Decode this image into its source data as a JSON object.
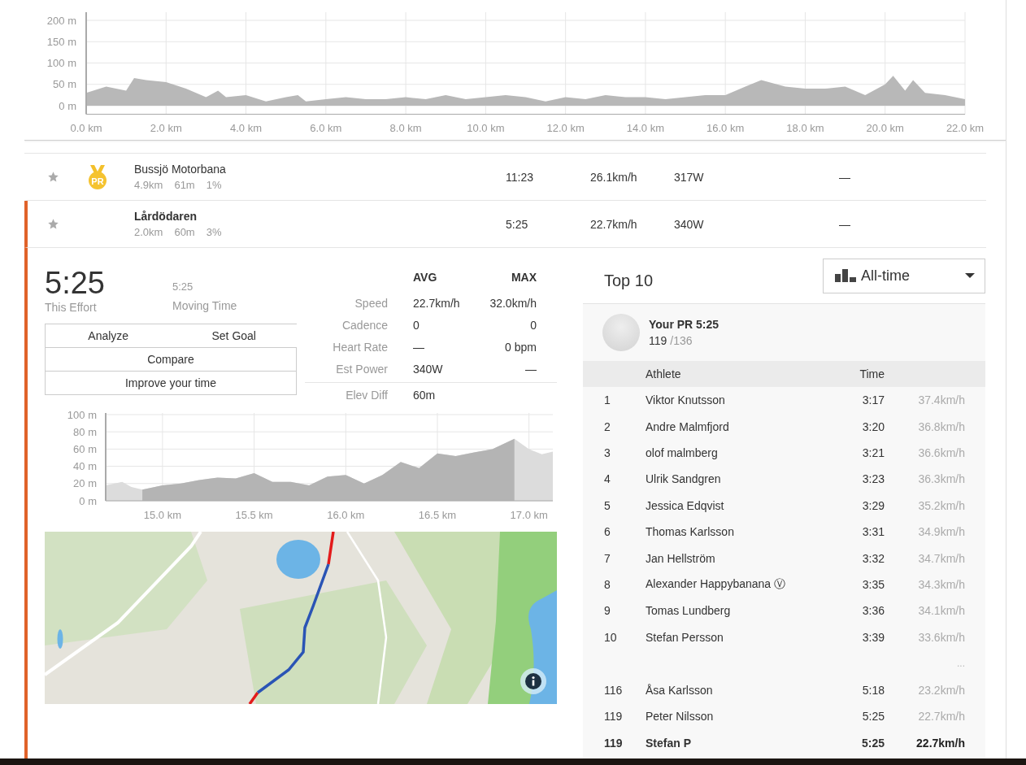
{
  "elevation_profile": {
    "chart_data": {
      "type": "area",
      "x": [
        0,
        0.5,
        1,
        1.2,
        1.5,
        2,
        2.5,
        3,
        3.3,
        3.5,
        4,
        4.5,
        5,
        5.3,
        5.5,
        6,
        6.5,
        7,
        7.5,
        8,
        8.5,
        9,
        9.5,
        10,
        10.5,
        11,
        11.5,
        12,
        12.5,
        13,
        13.5,
        14,
        14.5,
        15,
        15.5,
        16,
        16.5,
        16.9,
        17.5,
        18,
        18.5,
        19,
        19.5,
        20,
        20.2,
        20.5,
        20.7,
        21,
        21.5,
        22
      ],
      "grid": true,
      "series": [
        {
          "color": "#b8b8b8",
          "values": [
            30,
            45,
            35,
            65,
            60,
            55,
            40,
            20,
            35,
            20,
            25,
            10,
            20,
            25,
            10,
            15,
            20,
            15,
            15,
            20,
            15,
            25,
            15,
            20,
            25,
            20,
            10,
            20,
            15,
            25,
            20,
            20,
            15,
            20,
            25,
            25,
            45,
            60,
            45,
            40,
            40,
            45,
            25,
            50,
            70,
            35,
            60,
            30,
            25,
            15
          ]
        }
      ],
      "xlim": [
        0,
        22
      ],
      "ylim": [
        -20,
        200
      ],
      "xticks": [
        {
          "value": 0,
          "label": "0.0 km"
        },
        {
          "value": 2,
          "label": "2.0 km"
        },
        {
          "value": 4,
          "label": "4.0 km"
        },
        {
          "value": 6,
          "label": "6.0 km"
        },
        {
          "value": 8,
          "label": "8.0 km"
        },
        {
          "value": 10,
          "label": "10.0 km"
        },
        {
          "value": 12,
          "label": "12.0 km"
        },
        {
          "value": 14,
          "label": "14.0 km"
        },
        {
          "value": 16,
          "label": "16.0 km"
        },
        {
          "value": 18,
          "label": "18.0 km"
        },
        {
          "value": 20,
          "label": "20.0 km"
        },
        {
          "value": 22,
          "label": "22.0 km"
        }
      ],
      "yticks": [
        {
          "value": 0,
          "label": "0 m"
        },
        {
          "value": 50,
          "label": "50 m"
        },
        {
          "value": 100,
          "label": "100 m"
        },
        {
          "value": 150,
          "label": "150 m"
        },
        {
          "value": 200,
          "label": "200 m"
        }
      ]
    }
  },
  "segments": [
    {
      "starred": false,
      "medal": "PR",
      "name": "Bussjö Motorbana",
      "distance": "4.9km",
      "elevation": "61m",
      "grade": "1%",
      "time": "11:23",
      "speed": "26.1km/h",
      "power": "317W",
      "column_7": "—",
      "selected": false
    },
    {
      "starred": false,
      "name": "Lårdödaren",
      "distance": "2.0km",
      "elevation": "60m",
      "grade": "3%",
      "time": "5:25",
      "speed": "22.7km/h",
      "power": "340W",
      "column_7": "—",
      "selected": true
    }
  ],
  "effort": {
    "time": "5:25",
    "time_label": "This Effort",
    "moving_time": "5:25",
    "moving_time_label": "Moving Time",
    "actions": [
      [
        "Analyze",
        "Set Goal"
      ],
      [
        "Compare"
      ],
      [
        "Improve your time"
      ]
    ],
    "stats": {
      "columns": [
        "AVG",
        "MAX"
      ],
      "rows": [
        {
          "kind": "metric",
          "label": "Speed",
          "avg": "22.7km/h",
          "max": "32.0km/h"
        },
        {
          "kind": "metric",
          "label": "Cadence",
          "avg": "0",
          "max": "0"
        },
        {
          "kind": "metric",
          "label": "Heart Rate",
          "avg": "—",
          "max": "0 bpm"
        },
        {
          "kind": "metric",
          "label": "Est Power",
          "avg": "340W",
          "max": "—"
        },
        {
          "kind": "total",
          "label": "Elev Diff",
          "avg": "60m"
        }
      ]
    },
    "chart_data": {
      "type": "area",
      "x": [
        14.69,
        14.78,
        14.83,
        14.89,
        15.0,
        15.1,
        15.2,
        15.3,
        15.4,
        15.5,
        15.6,
        15.7,
        15.8,
        15.9,
        16.0,
        16.1,
        16.2,
        16.3,
        16.4,
        16.5,
        16.6,
        16.7,
        16.8,
        16.92,
        17.0,
        17.07,
        17.13
      ],
      "grid": true,
      "series": [
        {
          "color": "#dcdcdc",
          "values": [
            18,
            22,
            16,
            13,
            18,
            20,
            24,
            27,
            26,
            32,
            22,
            22,
            18,
            28,
            30,
            20,
            30,
            45,
            38,
            55,
            52,
            56,
            60,
            72,
            60,
            54,
            57
          ]
        },
        {
          "color": "#b4b4b4",
          "values": [
            null,
            null,
            null,
            13,
            18,
            20,
            24,
            27,
            26,
            32,
            22,
            22,
            18,
            28,
            30,
            20,
            30,
            45,
            38,
            55,
            52,
            56,
            60,
            72,
            null,
            null,
            null
          ]
        }
      ],
      "xlim": [
        14.69,
        17.13
      ],
      "ylim": [
        0,
        100
      ],
      "xticks": [
        {
          "value": 15,
          "label": "15.0 km"
        },
        {
          "value": 15.5,
          "label": "15.5 km"
        },
        {
          "value": 16,
          "label": "16.0 km"
        },
        {
          "value": 16.5,
          "label": "16.5 km"
        },
        {
          "value": 17,
          "label": "17.0 km"
        }
      ],
      "yticks": [
        {
          "value": 0,
          "label": "0 m"
        },
        {
          "value": 20,
          "label": "20 m"
        },
        {
          "value": 40,
          "label": "40 m"
        },
        {
          "value": 60,
          "label": "60 m"
        },
        {
          "value": 80,
          "label": "80 m"
        },
        {
          "value": 100,
          "label": "100 m"
        }
      ]
    },
    "map": {
      "kind": "picture"
    }
  },
  "leaderboard": {
    "title": "Top 10",
    "filter": "All-time",
    "pr": {
      "label": "Your PR 5:25",
      "rank": "119",
      "total": "/136"
    },
    "columns": [
      "Athlete",
      "Time"
    ],
    "rows": [
      {
        "rank": "1",
        "name": "Viktor Knutsson",
        "time": "3:17",
        "speed": "37.4km/h",
        "current_athlete": false
      },
      {
        "rank": "2",
        "name": "Andre Malmfjord",
        "time": "3:20",
        "speed": "36.8km/h",
        "current_athlete": false
      },
      {
        "rank": "3",
        "name": "olof malmberg",
        "time": "3:21",
        "speed": "36.6km/h",
        "current_athlete": false
      },
      {
        "rank": "4",
        "name": "Ulrik Sandgren",
        "time": "3:23",
        "speed": "36.3km/h",
        "current_athlete": false
      },
      {
        "rank": "5",
        "name": "Jessica Edqvist",
        "time": "3:29",
        "speed": "35.2km/h",
        "current_athlete": false
      },
      {
        "rank": "6",
        "name": "Thomas Karlsson",
        "time": "3:31",
        "speed": "34.9km/h",
        "current_athlete": false
      },
      {
        "rank": "7",
        "name": "Jan Hellström",
        "time": "3:32",
        "speed": "34.7km/h",
        "current_athlete": false
      },
      {
        "rank": "8",
        "name": "Alexander Happybanana Ⓥ",
        "time": "3:35",
        "speed": "34.3km/h",
        "current_athlete": false
      },
      {
        "rank": "9",
        "name": "Tomas Lundberg",
        "time": "3:36",
        "speed": "34.1km/h",
        "current_athlete": false
      },
      {
        "rank": "10",
        "name": "Stefan Persson",
        "time": "3:39",
        "speed": "33.6km/h",
        "current_athlete": false
      }
    ],
    "gap": "...",
    "nearby": [
      {
        "rank": "116",
        "name": "Åsa Karlsson",
        "time": "5:18",
        "speed": "23.2km/h",
        "current_athlete": false
      },
      {
        "rank": "119",
        "name": "Peter Nilsson",
        "time": "5:25",
        "speed": "22.7km/h",
        "current_athlete": false
      },
      {
        "rank": "119",
        "name": "Stefan P",
        "time": "5:25",
        "speed": "22.7km/h",
        "current_athlete": true
      }
    ]
  }
}
